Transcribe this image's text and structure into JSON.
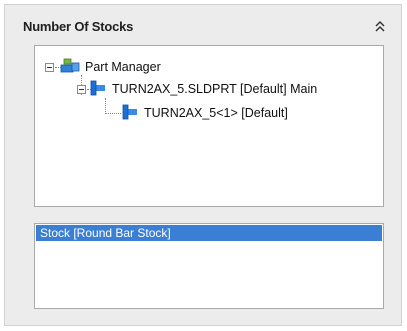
{
  "panel": {
    "title": "Number Of Stocks",
    "collapse_icon": "double-chevron-up-icon"
  },
  "tree": {
    "root": {
      "label": "Part Manager",
      "icon": "part-manager-icon",
      "expanded": true
    },
    "part": {
      "label": "TURN2AX_5.SLDPRT [Default] Main",
      "icon": "part-icon",
      "expanded": true
    },
    "instance": {
      "label": "TURN2AX_5<1> [Default]",
      "icon": "part-icon"
    }
  },
  "stock_list": {
    "items": [
      {
        "label": "Stock [Round Bar Stock]",
        "selected": true
      }
    ]
  },
  "colors": {
    "selection": "#3b7fd4",
    "part_icon": "#1d6fd6",
    "panel_bg": "#ececec"
  }
}
